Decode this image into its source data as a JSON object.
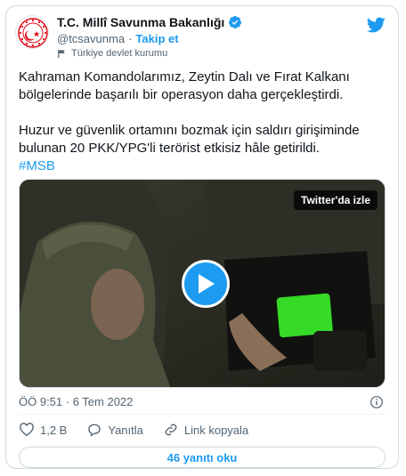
{
  "author": {
    "name": "T.C. Millî Savunma Bakanlığı",
    "handle": "@tcsavunma",
    "separator": "·",
    "follow_label": "Takip et",
    "account_label": "Türkiye devlet kurumu"
  },
  "tweet": {
    "paragraph1": "Kahraman Komandolarımız, Zeytin Dalı ve Fırat Kalkanı bölgelerinde başarılı bir operasyon daha gerçekleştirdi.",
    "paragraph2": "Huzur ve güvenlik ortamını bozmak için saldırı girişiminde bulunan 20 PKK/YPG'li terörist etkisiz hâle getirildi.",
    "hashtag": "#MSB"
  },
  "media": {
    "watch_label": "Twitter'da izle"
  },
  "meta": {
    "timestamp": "ÖÖ 9:51 · 6 Tem 2022"
  },
  "actions": {
    "likes": "1,2 B",
    "reply_label": "Yanıtla",
    "copy_link_label": "Link kopyala"
  },
  "replies_button": "46 yanıtı oku",
  "colors": {
    "accent": "#1d9bf0",
    "verified": "#1d9bf0",
    "ministry_red": "#e30a17"
  }
}
